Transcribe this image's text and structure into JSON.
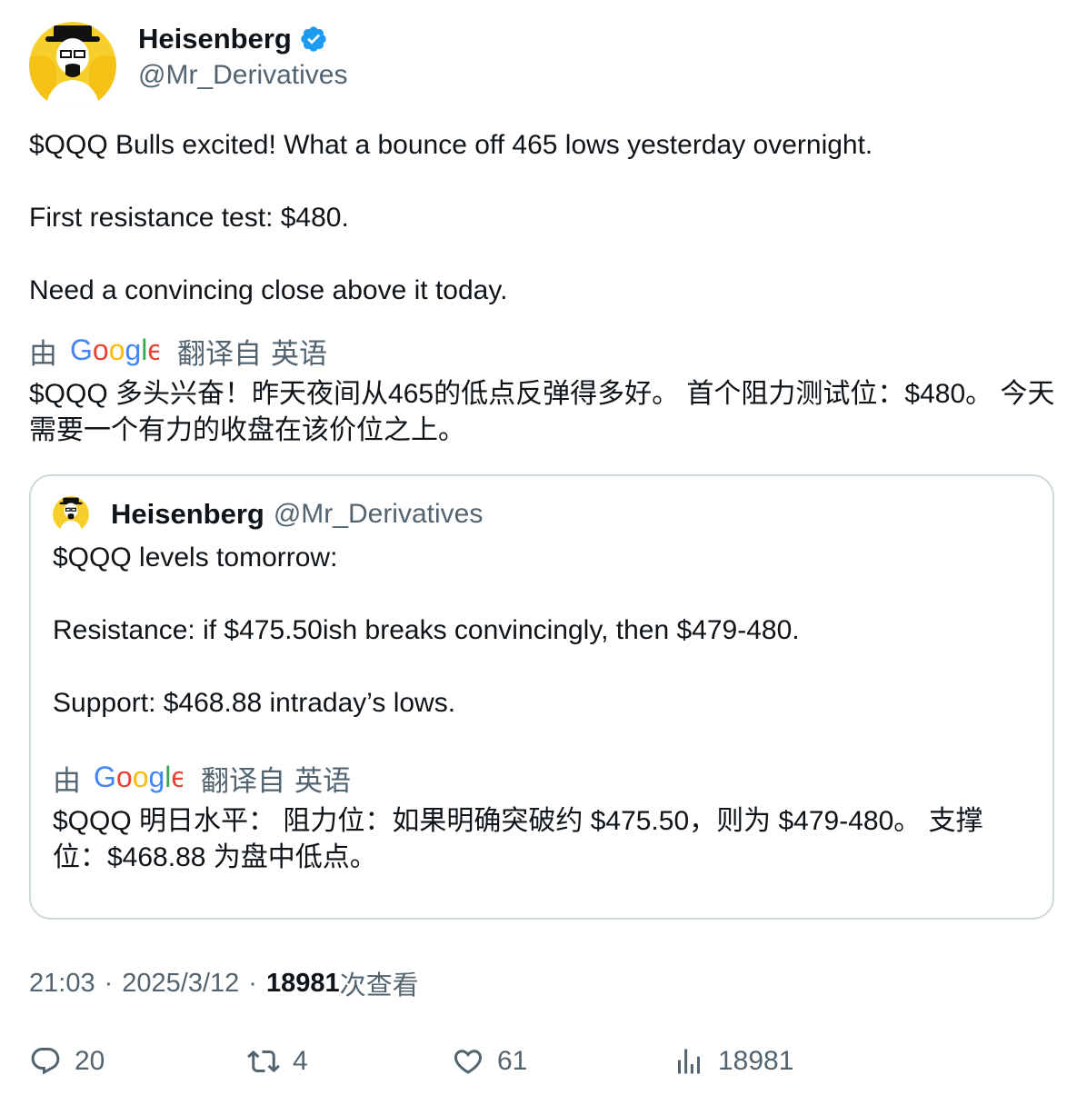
{
  "author": {
    "display_name": "Heisenberg",
    "handle": "@Mr_Derivatives",
    "verified": true
  },
  "tweet": {
    "paragraphs": [
      "$QQQ Bulls excited! What a bounce off 465 lows yesterday overnight.",
      "First resistance test: $480.",
      "Need a convincing close above it today."
    ],
    "translate_prefix": "由",
    "translate_brand": "Google",
    "translate_suffix": "翻译自",
    "translate_lang": "英语",
    "translated_text": "$QQQ 多头兴奋！昨天夜间从465的低点反弹得多好。 首个阻力测试位：$480。 今天需要一个有力的收盘在该价位之上。"
  },
  "quoted": {
    "display_name": "Heisenberg",
    "handle": "@Mr_Derivatives",
    "paragraphs": [
      "$QQQ levels tomorrow:",
      "Resistance: if $475.50ish breaks convincingly, then $479-480.",
      "Support: $468.88 intraday’s lows."
    ],
    "translate_prefix": "由",
    "translate_brand": "Google",
    "translate_suffix": "翻译自",
    "translate_lang": "英语",
    "translated_text": "$QQQ 明日水平： 阻力位：如果明确突破约 $475.50，则为 $479-480。 支撑位：$468.88 为盘中低点。"
  },
  "meta": {
    "time": "21:03",
    "separator": "·",
    "date": "2025/3/12",
    "views_count": "18981",
    "views_label": "次查看"
  },
  "actions": {
    "replies": "20",
    "retweets": "4",
    "likes": "61",
    "views": "18981"
  },
  "colors": {
    "text": "#0f1419",
    "secondary": "#536471",
    "border": "#cfd9de",
    "verified": "#1d9bf0",
    "avatar_bg": "#f5c518"
  }
}
